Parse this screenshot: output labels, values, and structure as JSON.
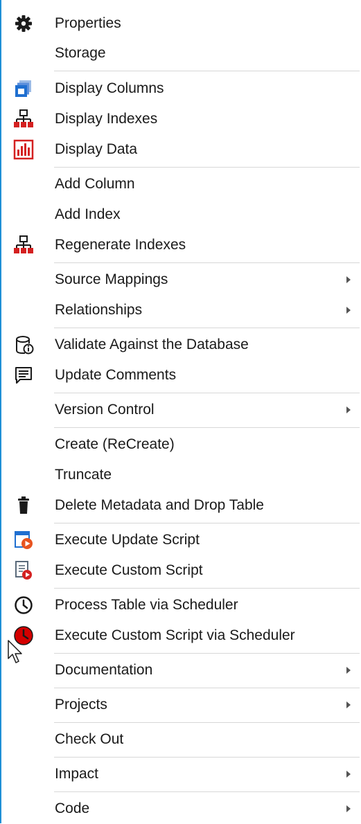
{
  "menu": {
    "items": [
      {
        "label": "Properties",
        "icon": "gear-icon"
      },
      {
        "label": "Storage",
        "icon": null
      },
      {
        "label": "Display Columns",
        "icon": "display-columns-icon"
      },
      {
        "label": "Display Indexes",
        "icon": "indexes-hierarchy-icon"
      },
      {
        "label": "Display Data",
        "icon": "bar-data-icon"
      },
      {
        "label": "Add Column",
        "icon": null
      },
      {
        "label": "Add Index",
        "icon": null
      },
      {
        "label": "Regenerate Indexes",
        "icon": "indexes-hierarchy-icon"
      },
      {
        "label": "Source Mappings",
        "icon": null,
        "submenu": true
      },
      {
        "label": "Relationships",
        "icon": null,
        "submenu": true
      },
      {
        "label": "Validate Against the Database",
        "icon": "database-validate-icon"
      },
      {
        "label": "Update Comments",
        "icon": "comment-icon"
      },
      {
        "label": "Version Control",
        "icon": null,
        "submenu": true
      },
      {
        "label": "Create (ReCreate)",
        "icon": null
      },
      {
        "label": "Truncate",
        "icon": null
      },
      {
        "label": "Delete Metadata and Drop Table",
        "icon": "trash-icon"
      },
      {
        "label": "Execute Update Script",
        "icon": "execute-update-script-icon"
      },
      {
        "label": "Execute Custom Script",
        "icon": "execute-custom-script-icon"
      },
      {
        "label": "Process Table via Scheduler",
        "icon": "clock-icon"
      },
      {
        "label": "Execute Custom Script via Scheduler",
        "icon": "red-clock-icon"
      },
      {
        "label": "Documentation",
        "icon": null,
        "submenu": true
      },
      {
        "label": "Projects",
        "icon": null,
        "submenu": true
      },
      {
        "label": "Check Out",
        "icon": null
      },
      {
        "label": "Impact",
        "icon": null,
        "submenu": true
      },
      {
        "label": "Code",
        "icon": null,
        "submenu": true
      }
    ]
  },
  "colors": {
    "accent_border": "#1e8fd6",
    "separator": "#d7d7d7",
    "icon_blue": "#1f6fd0",
    "icon_red": "#d42020",
    "icon_dark": "#1a1a1a"
  }
}
